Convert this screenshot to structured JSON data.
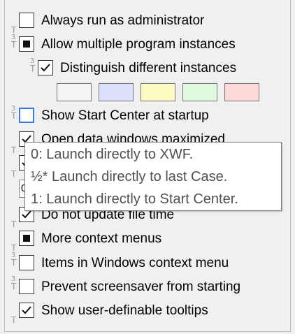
{
  "options": [
    {
      "label": "Always run as administrator",
      "state": "unchecked",
      "badge": ""
    },
    {
      "label": "Allow multiple program instances",
      "state": "indeterminate",
      "badge": "3"
    },
    {
      "label": "Distinguish different instances",
      "state": "checked",
      "badge": "3"
    },
    {
      "label": "Show Start Center at startup",
      "state": "focused-unchecked",
      "badge": "3"
    },
    {
      "label": "Open data windows maximized",
      "state": "checked",
      "badge": ""
    },
    {
      "label": "Do not update file time",
      "state": "checked",
      "badge": ""
    },
    {
      "label": "More context menus",
      "state": "indeterminate",
      "badge": ""
    },
    {
      "label": "Items in Windows context menu",
      "state": "unchecked",
      "badge": "3"
    },
    {
      "label": "Prevent screensaver from starting",
      "state": "unchecked",
      "badge": "3"
    },
    {
      "label": "Show user-definable tooltips",
      "state": "checked",
      "badge": ""
    }
  ],
  "tri_glyph": "T",
  "swatches": [
    "#f5f5f5",
    "#dde0fb",
    "#fdfcc0",
    "#def9de",
    "#fdd9d9"
  ],
  "hidden_dropdown_value": "0",
  "tooltip": {
    "lines": [
      "0: Launch directly to XWF.",
      "½* Launch directly to last Case.",
      "1: Launch directly to Start Center."
    ]
  }
}
